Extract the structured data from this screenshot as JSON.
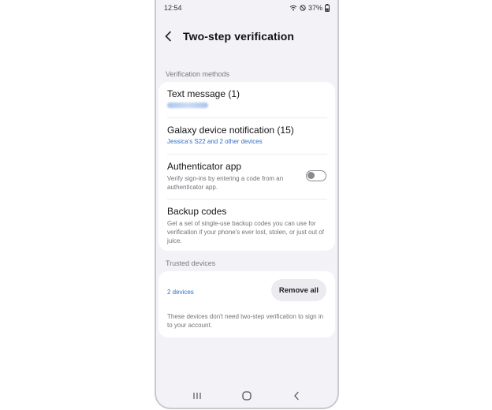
{
  "status": {
    "time": "12:54",
    "battery": "37%"
  },
  "header": {
    "title": "Two-step verification"
  },
  "verification": {
    "section_label": "Verification methods",
    "text_message": {
      "title": "Text message (1)"
    },
    "galaxy": {
      "title": "Galaxy device notification (15)",
      "link": "Jessica's S22 and  2 other devices"
    },
    "authenticator": {
      "title": "Authenticator app",
      "subtitle": "Verify sign-ins by entering a code from an authenticator app.",
      "enabled": false
    },
    "backup": {
      "title": "Backup codes",
      "subtitle": "Get a set of single-use backup codes you can use for verification if your phone's ever lost, stolen, or just out of juice."
    }
  },
  "trusted": {
    "section_label": "Trusted devices",
    "devices_link": "2 devices",
    "remove_label": "Remove all",
    "note": "These devices don't need two-step verification to sign in to your account."
  },
  "icons": {
    "back": "chevron-left-icon",
    "wifi": "wifi-icon",
    "dnd": "do-not-disturb-icon",
    "battery": "battery-icon",
    "recents": "recents-icon",
    "home": "home-icon",
    "nav_back": "nav-back-icon"
  },
  "colors": {
    "background": "#f3f2f7",
    "card": "#ffffff",
    "link": "#2f6fc9"
  }
}
